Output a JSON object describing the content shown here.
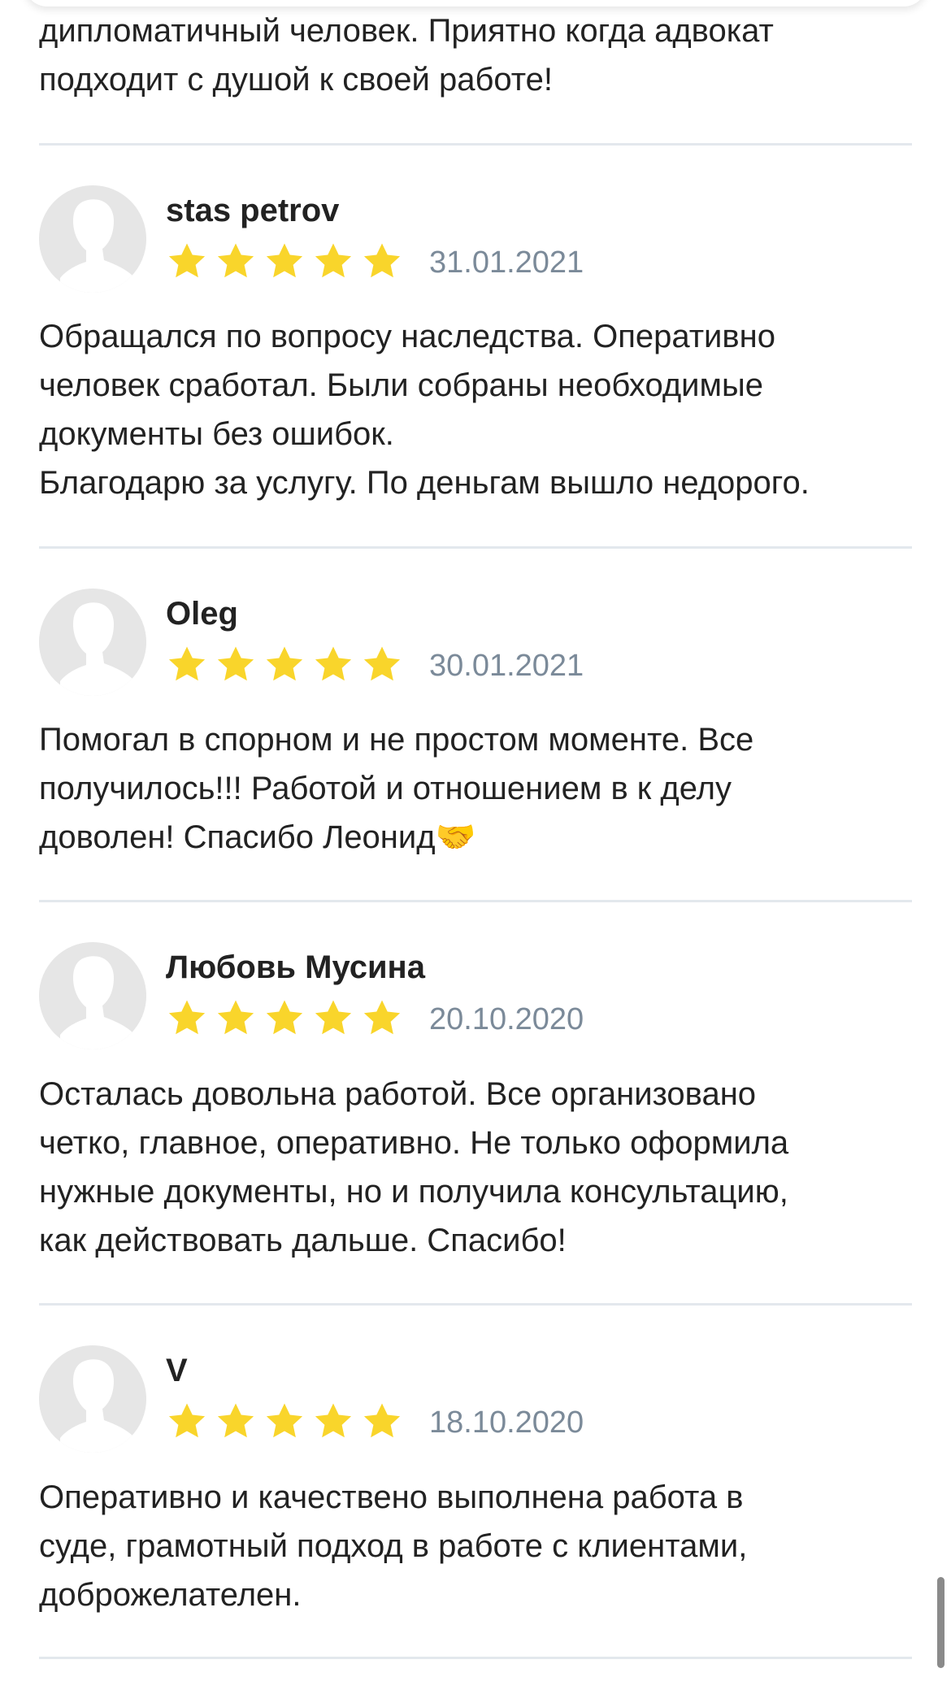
{
  "prev_review": {
    "text": "дипломатичный человек. Приятно когда адвокат\nподходит с душой к своей работе!"
  },
  "reviews": [
    {
      "author": "stas petrov",
      "rating": 5,
      "date": "31.01.2021",
      "text": "Обращался по вопросу наследства. Оперативно\nчеловек сработал. Были собраны необходимые\nдокументы без ошибок.\nБлагодарю за услугу. По деньгам вышло недорого."
    },
    {
      "author": "Oleg",
      "rating": 5,
      "date": "30.01.2021",
      "text": "Помогал в спорном и не простом моменте. Все\nполучилось!!! Работой и отношением в к делу\nдоволен! Спасибо Леонид🤝"
    },
    {
      "author": "Любовь Мусина",
      "rating": 5,
      "date": "20.10.2020",
      "text": "Осталась довольна работой. Все организовано\nчетко, главное, оперативно. Не только оформила\nнужные документы, но и получила консультацию,\nкак действовать дальше. Спасибо!"
    },
    {
      "author": "V",
      "rating": 5,
      "date": "18.10.2020",
      "text": "Оперативно и качествено выполнена работа в\nсуде, грамотный подход в работе с клиентами,\nдоброжелателен."
    }
  ],
  "colors": {
    "star": "#f9d52b",
    "date": "#7b8a99",
    "separator": "#e3e8ed",
    "avatar_bg": "#e6e6e6"
  },
  "icons": {
    "avatar": "user-silhouette-icon",
    "star": "star-icon"
  }
}
